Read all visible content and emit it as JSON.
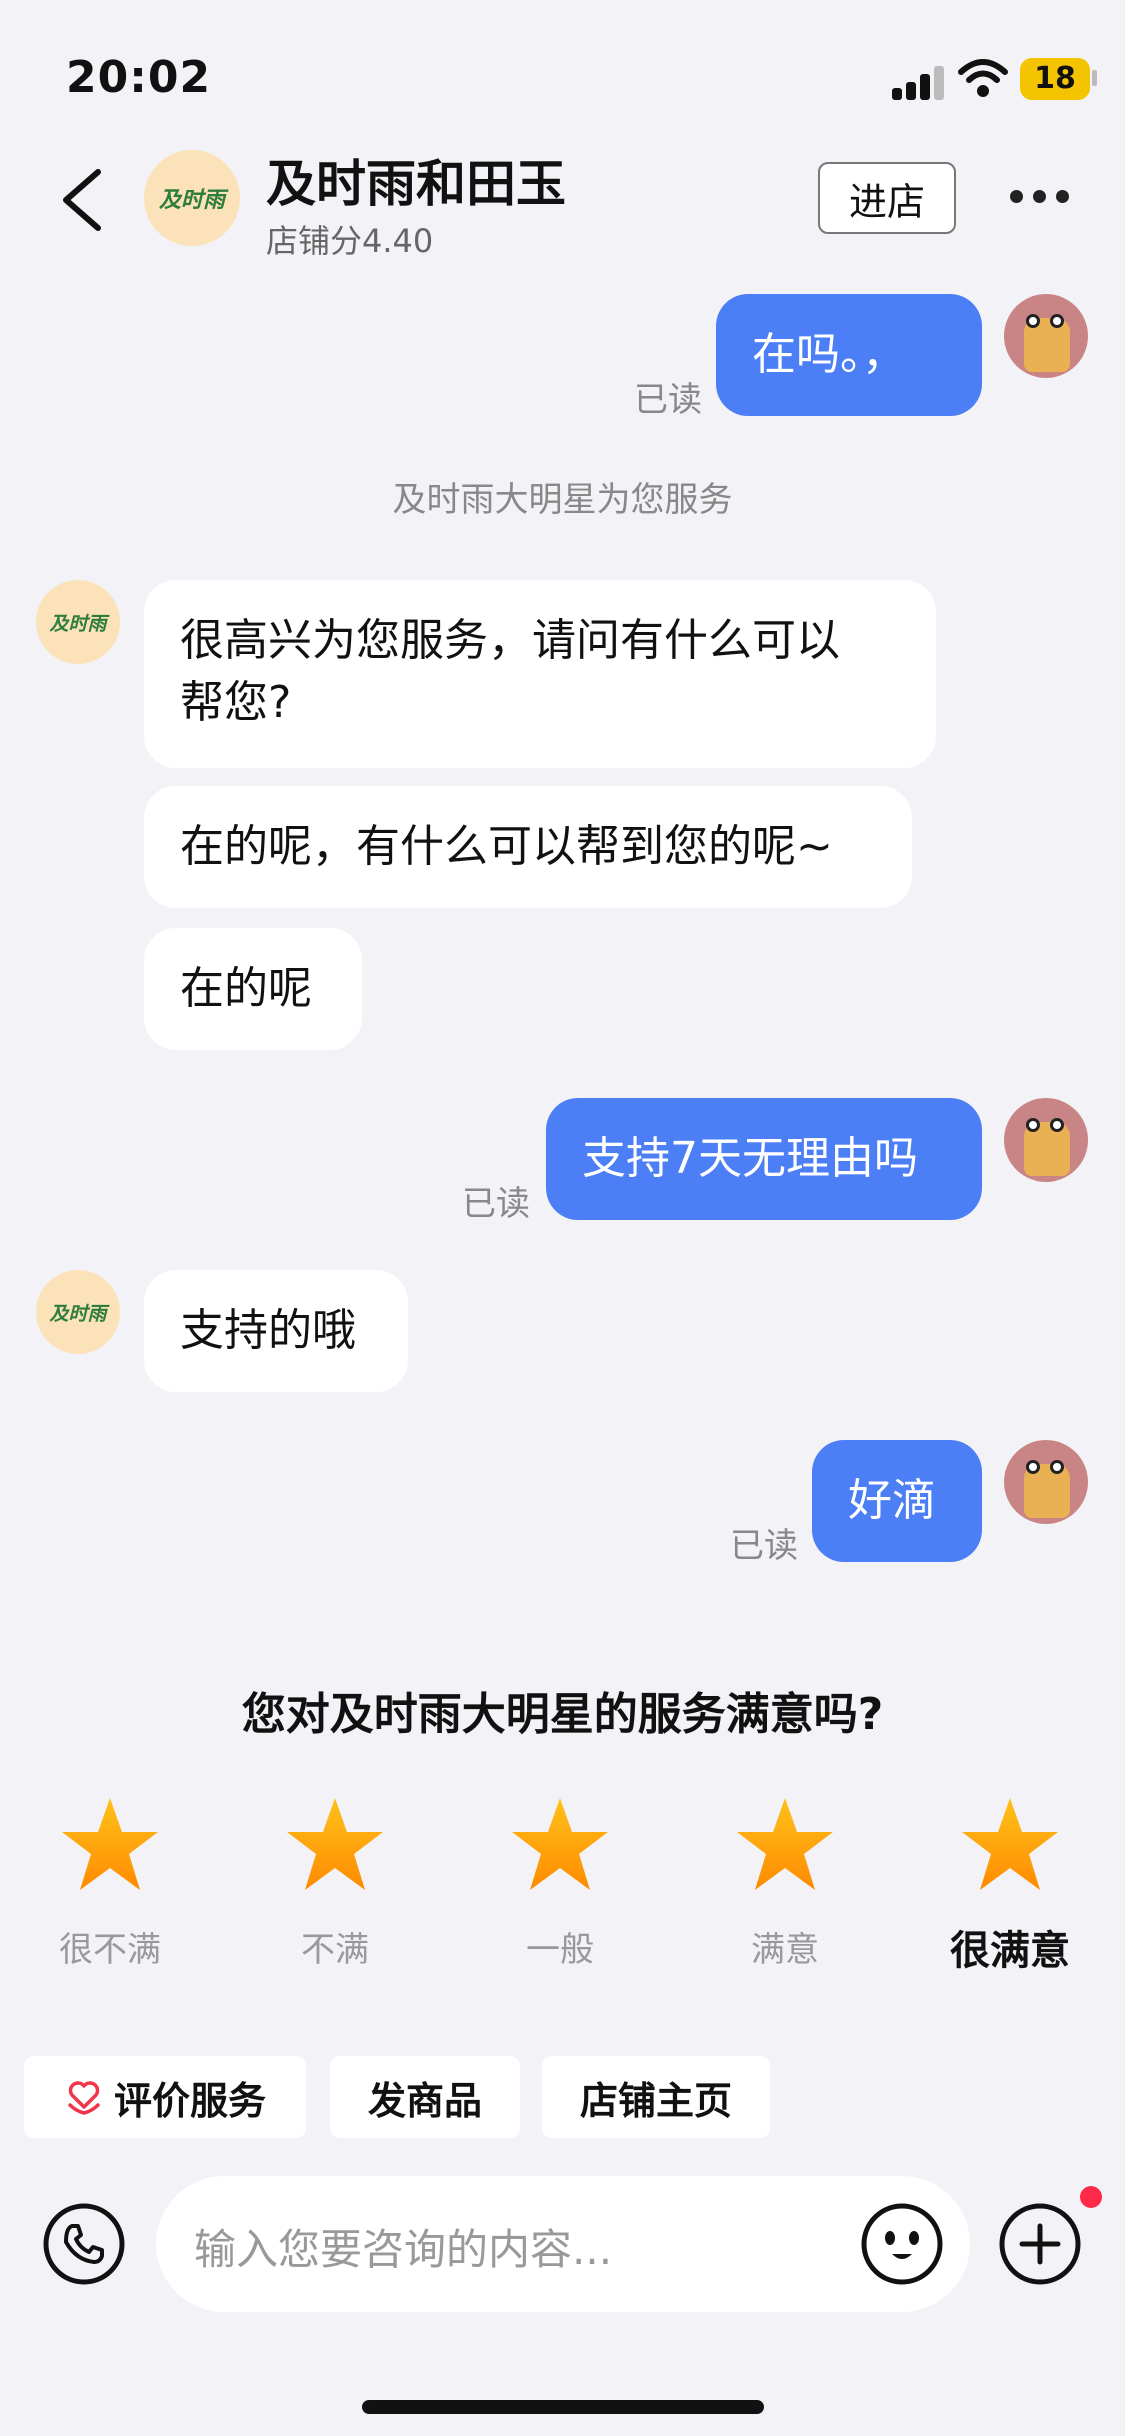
{
  "status": {
    "time": "20:02",
    "battery": "18"
  },
  "header": {
    "shop_name": "及时雨和田玉",
    "shop_score": "店铺分4.40",
    "avatar_text": "及时雨",
    "enter_label": "进店"
  },
  "messages": {
    "m1": {
      "text": "在吗。，",
      "read": "已读"
    },
    "system_note": "及时雨大明星为您服务",
    "agent_avatar_text": "及时雨",
    "a1_line1": "很高兴为您服务，请问有什么可以",
    "a1_line2": "帮您?",
    "a2": "在的呢，有什么可以帮到您的呢~",
    "a3": "在的呢",
    "m2": {
      "text": "支持7天无理由吗",
      "read": "已读"
    },
    "a4": "支持的哦",
    "m3": {
      "text": "好滴",
      "read": "已读"
    }
  },
  "rating": {
    "title": "您对及时雨大明星的服务满意吗?",
    "labels": [
      "很不满",
      "不满",
      "一般",
      "满意",
      "很满意"
    ],
    "star_color": "#ff9f00"
  },
  "actions": [
    "评价服务",
    "发商品",
    "店铺主页"
  ],
  "input": {
    "placeholder": "输入您要咨询的内容..."
  },
  "colors": {
    "outgoing_bubble": "#4c7ff5",
    "background": "#f3f3f7",
    "badge": "#ff2a4a"
  }
}
